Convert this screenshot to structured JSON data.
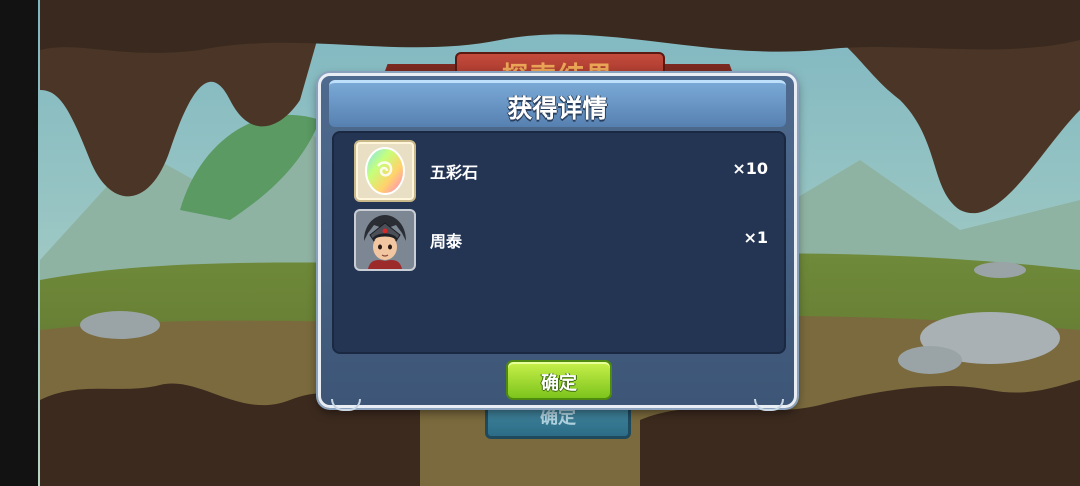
{
  "background": {
    "banner_title": "探索结果",
    "confirm_label": "确定"
  },
  "dialog": {
    "title": "获得详情",
    "items": [
      {
        "name": "五彩石",
        "quantity": "×10",
        "icon": "rainbow-stone-icon"
      },
      {
        "name": "周泰",
        "quantity": "×1",
        "icon": "hero-portrait-icon"
      }
    ],
    "confirm_label": "确定"
  },
  "colors": {
    "dialog_body": "#4e6a8e",
    "list_bg": "#243554",
    "confirm_green": "#8fd22a"
  }
}
